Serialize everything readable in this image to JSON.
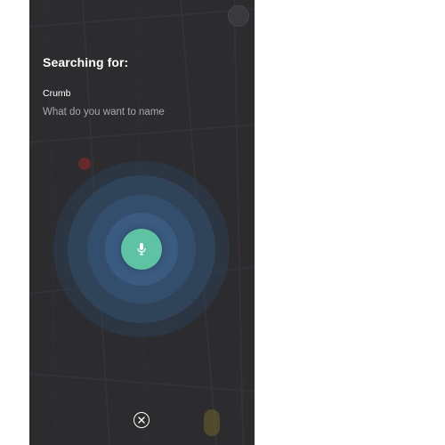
{
  "search": {
    "heading": "Searching for:",
    "term": "Crumb",
    "placeholder": "What do you want to name"
  },
  "icons": {
    "mic": "microphone-icon",
    "close": "close-icon",
    "avatar": "user-avatar"
  },
  "colors": {
    "screen_bg": "#2c2c2f",
    "mic_button": "#5ec3a3",
    "ripple": "#3a5a80",
    "text": "#ffffff",
    "placeholder": "#a9a9ad"
  }
}
